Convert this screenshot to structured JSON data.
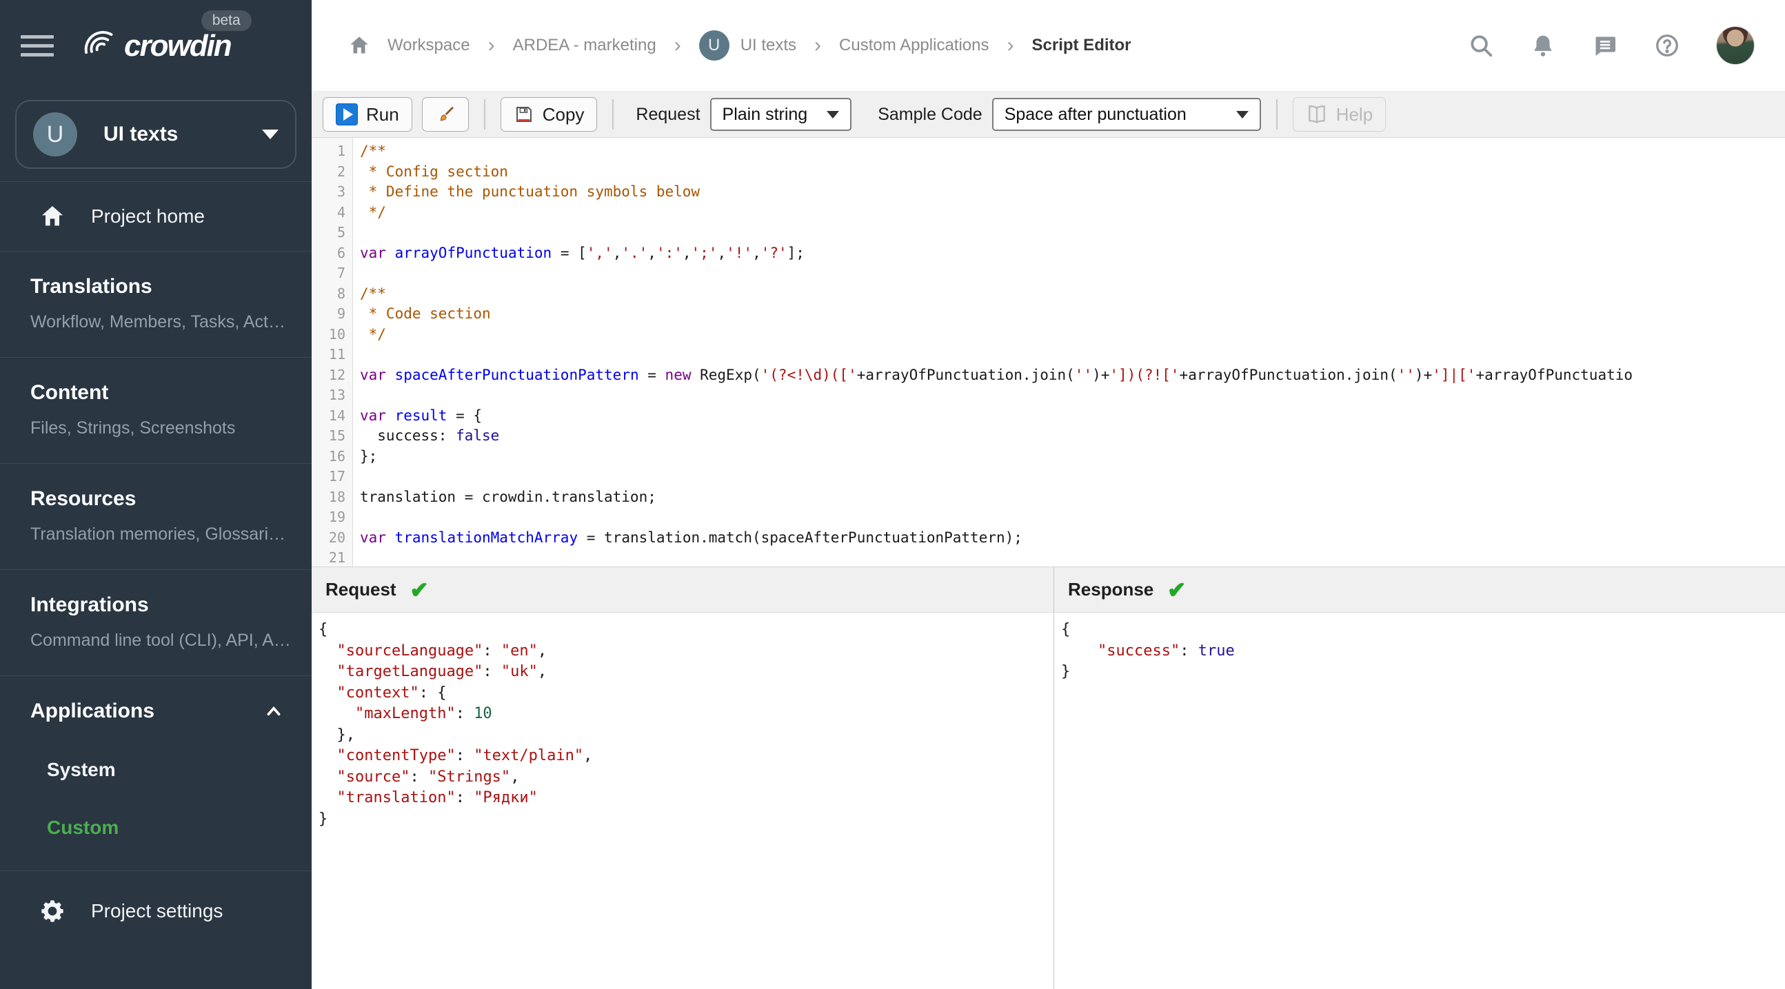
{
  "brand": {
    "logo_text": "crowdin",
    "beta_badge": "beta"
  },
  "sidebar": {
    "project": {
      "initial": "U",
      "name": "UI texts"
    },
    "project_home": "Project home",
    "sections": [
      {
        "title": "Translations",
        "subtitle": "Workflow, Members, Tasks, Act…"
      },
      {
        "title": "Content",
        "subtitle": "Files, Strings, Screenshots"
      },
      {
        "title": "Resources",
        "subtitle": "Translation memories, Glossari…"
      },
      {
        "title": "Integrations",
        "subtitle": "Command line tool (CLI), API, A…"
      }
    ],
    "applications": {
      "title": "Applications",
      "items": [
        {
          "label": "System"
        },
        {
          "label": "Custom"
        }
      ]
    },
    "project_settings": "Project settings",
    "accent_green": "#4cae50"
  },
  "header": {
    "breadcrumbs": [
      {
        "label": "Workspace"
      },
      {
        "label": "ARDEA - marketing"
      },
      {
        "label": "UI texts",
        "avatar_initial": "U"
      },
      {
        "label": "Custom Applications"
      },
      {
        "label": "Script Editor",
        "current": true
      }
    ]
  },
  "toolbar": {
    "run_label": "Run",
    "copy_label": "Copy",
    "request_label": "Request",
    "request_value": "Plain string",
    "sample_code_label": "Sample Code",
    "sample_code_value": "Space after punctuation",
    "help_label": "Help"
  },
  "editor": {
    "lines": [
      {
        "n": 1,
        "segs": [
          [
            "com",
            "/**"
          ]
        ]
      },
      {
        "n": 2,
        "segs": [
          [
            "com",
            " * Config section"
          ]
        ]
      },
      {
        "n": 3,
        "segs": [
          [
            "com",
            " * Define the punctuation symbols below"
          ]
        ]
      },
      {
        "n": 4,
        "segs": [
          [
            "com",
            " */"
          ]
        ]
      },
      {
        "n": 5,
        "segs": []
      },
      {
        "n": 6,
        "segs": [
          [
            "kw",
            "var"
          ],
          [
            "pl",
            " "
          ],
          [
            "def",
            "arrayOfPunctuation"
          ],
          [
            "pl",
            " = ["
          ],
          [
            "str",
            "','"
          ],
          [
            "pl",
            ","
          ],
          [
            "str",
            "'.'"
          ],
          [
            "pl",
            ","
          ],
          [
            "str",
            "':'"
          ],
          [
            "pl",
            ","
          ],
          [
            "str",
            "';'"
          ],
          [
            "pl",
            ","
          ],
          [
            "str",
            "'!'"
          ],
          [
            "pl",
            ","
          ],
          [
            "str",
            "'?'"
          ],
          [
            "pl",
            "];"
          ]
        ]
      },
      {
        "n": 7,
        "segs": []
      },
      {
        "n": 8,
        "segs": [
          [
            "com",
            "/**"
          ]
        ]
      },
      {
        "n": 9,
        "segs": [
          [
            "com",
            " * Code section"
          ]
        ]
      },
      {
        "n": 10,
        "segs": [
          [
            "com",
            " */"
          ]
        ]
      },
      {
        "n": 11,
        "segs": []
      },
      {
        "n": 12,
        "segs": [
          [
            "kw",
            "var"
          ],
          [
            "pl",
            " "
          ],
          [
            "def",
            "spaceAfterPunctuationPattern"
          ],
          [
            "pl",
            " = "
          ],
          [
            "kw",
            "new"
          ],
          [
            "pl",
            " RegExp("
          ],
          [
            "str",
            "'(?<!\\d)(['"
          ],
          [
            "pl",
            "+arrayOfPunctuation.join("
          ],
          [
            "str",
            "''"
          ],
          [
            "pl",
            ")+"
          ],
          [
            "str",
            "'])(?!['"
          ],
          [
            "pl",
            "+arrayOfPunctuation.join("
          ],
          [
            "str",
            "''"
          ],
          [
            "pl",
            ")+"
          ],
          [
            "str",
            "']|['"
          ],
          [
            "pl",
            "+arrayOfPunctuatio"
          ]
        ]
      },
      {
        "n": 13,
        "segs": []
      },
      {
        "n": 14,
        "segs": [
          [
            "kw",
            "var"
          ],
          [
            "pl",
            " "
          ],
          [
            "def",
            "result"
          ],
          [
            "pl",
            " = {"
          ]
        ]
      },
      {
        "n": 15,
        "segs": [
          [
            "pl",
            "  success: "
          ],
          [
            "atom",
            "false"
          ]
        ]
      },
      {
        "n": 16,
        "segs": [
          [
            "pl",
            "};"
          ]
        ]
      },
      {
        "n": 17,
        "segs": []
      },
      {
        "n": 18,
        "segs": [
          [
            "pl",
            "translation = crowdin.translation;"
          ]
        ]
      },
      {
        "n": 19,
        "segs": []
      },
      {
        "n": 20,
        "segs": [
          [
            "kw",
            "var"
          ],
          [
            "pl",
            " "
          ],
          [
            "def",
            "translationMatchArray"
          ],
          [
            "pl",
            " = translation.match(spaceAfterPunctuationPattern);"
          ]
        ]
      },
      {
        "n": 21,
        "segs": []
      }
    ]
  },
  "panels": {
    "request": {
      "title": "Request",
      "status_icon": "✔",
      "lines": [
        {
          "segs": [
            [
              "pl",
              "{"
            ]
          ]
        },
        {
          "segs": [
            [
              "pl",
              "  "
            ],
            [
              "str",
              "\"sourceLanguage\""
            ],
            [
              "pl",
              ": "
            ],
            [
              "str",
              "\"en\""
            ],
            [
              "pl",
              ","
            ]
          ]
        },
        {
          "segs": [
            [
              "pl",
              "  "
            ],
            [
              "str",
              "\"targetLanguage\""
            ],
            [
              "pl",
              ": "
            ],
            [
              "str",
              "\"uk\""
            ],
            [
              "pl",
              ","
            ]
          ]
        },
        {
          "segs": [
            [
              "pl",
              "  "
            ],
            [
              "str",
              "\"context\""
            ],
            [
              "pl",
              ": {"
            ]
          ]
        },
        {
          "segs": [
            [
              "pl",
              "    "
            ],
            [
              "str",
              "\"maxLength\""
            ],
            [
              "pl",
              ": "
            ],
            [
              "num",
              "10"
            ]
          ]
        },
        {
          "segs": [
            [
              "pl",
              "  },"
            ]
          ]
        },
        {
          "segs": [
            [
              "pl",
              "  "
            ],
            [
              "str",
              "\"contentType\""
            ],
            [
              "pl",
              ": "
            ],
            [
              "str",
              "\"text/plain\""
            ],
            [
              "pl",
              ","
            ]
          ]
        },
        {
          "segs": [
            [
              "pl",
              "  "
            ],
            [
              "str",
              "\"source\""
            ],
            [
              "pl",
              ": "
            ],
            [
              "str",
              "\"Strings\""
            ],
            [
              "pl",
              ","
            ]
          ]
        },
        {
          "segs": [
            [
              "pl",
              "  "
            ],
            [
              "str",
              "\"translation\""
            ],
            [
              "pl",
              ": "
            ],
            [
              "str",
              "\"Рядки\""
            ]
          ]
        },
        {
          "segs": [
            [
              "pl",
              "}"
            ]
          ]
        }
      ]
    },
    "response": {
      "title": "Response",
      "status_icon": "✔",
      "lines": [
        {
          "segs": [
            [
              "pl",
              "{"
            ]
          ]
        },
        {
          "segs": [
            [
              "pl",
              "    "
            ],
            [
              "str",
              "\"success\""
            ],
            [
              "pl",
              ": "
            ],
            [
              "atom",
              "true"
            ]
          ]
        },
        {
          "segs": [
            [
              "pl",
              "}"
            ]
          ]
        }
      ]
    }
  }
}
